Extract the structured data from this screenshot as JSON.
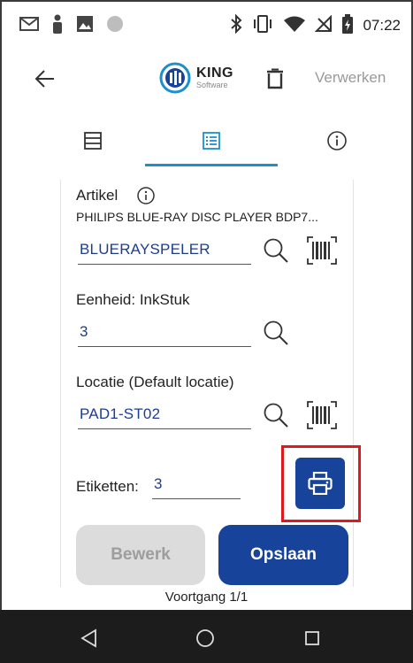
{
  "status_bar": {
    "time": "07:22",
    "icons": [
      "gmail-icon",
      "person-icon",
      "image-icon",
      "circle-icon",
      "bluetooth-icon",
      "vibrate-icon",
      "wifi-icon",
      "no-signal-icon",
      "battery-icon"
    ]
  },
  "app_bar": {
    "logo_name": "KING",
    "logo_sub": "Software",
    "process_label": "Verwerken"
  },
  "tabs": [
    {
      "icon": "list-lines-icon",
      "active": false
    },
    {
      "icon": "list-detail-icon",
      "active": true
    },
    {
      "icon": "info-icon",
      "active": false
    }
  ],
  "form": {
    "article_label": "Artikel",
    "article_description": "PHILIPS BLUE-RAY DISC PLAYER BDP7...",
    "article_value": "BLUERAYSPELER",
    "unit_label": "Eenheid: InkStuk",
    "quantity_value": "3",
    "location_label": "Locatie (Default locatie)",
    "location_value": "PAD1-ST02",
    "labels_label": "Etiketten:",
    "labels_value": "3"
  },
  "buttons": {
    "edit_label": "Bewerk",
    "save_label": "Opslaan"
  },
  "progress_text": "Voortgang 1/1",
  "colors": {
    "primary": "#17449a",
    "accent_tab": "#1b8fcf",
    "field_text": "#1d3d8f",
    "highlight": "#e0191e",
    "disabled_bg": "#dcdcdc"
  }
}
